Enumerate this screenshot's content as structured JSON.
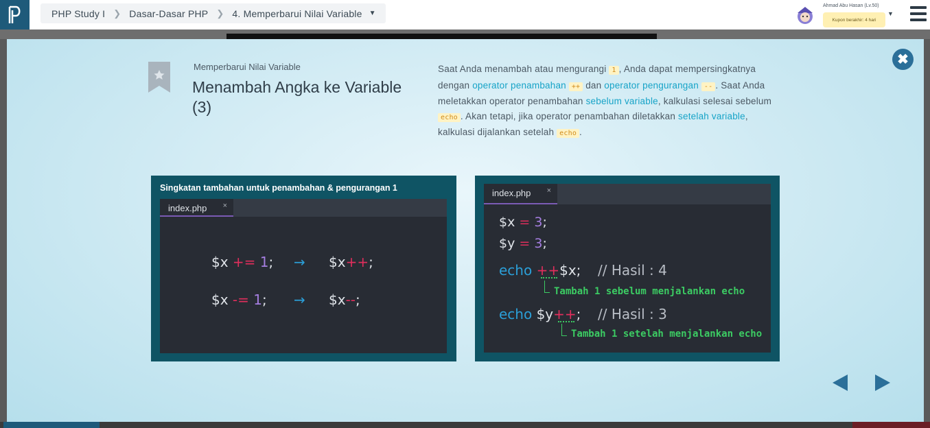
{
  "header": {
    "breadcrumb": [
      "PHP Study I",
      "Dasar-Dasar PHP",
      "4. Memperbarui Nilai Variable"
    ],
    "user_name": "Ahmad Abu Hasan (Lv.50)",
    "coupon": "Kupon berakhir: 4 hari"
  },
  "lesson": {
    "subtitle": "Memperbarui Nilai Variable",
    "title": "Menambah Angka ke Variable (3)",
    "desc": {
      "p1": "Saat Anda menambah atau mengurangi ",
      "c1": "1",
      "p2": ", Anda dapat mempersingkatnya dengan ",
      "h1": "operator penambahan",
      "c2": "++",
      "p3": " dan ",
      "h2": "operator pengurangan",
      "c3": "--",
      "p4": ". Saat Anda meletakkan operator penambahan ",
      "h3": "sebelum variable",
      "p5": ", kalkulasi selesai sebelum ",
      "c4": "echo",
      "p6": ". Akan tetapi, jika operator penambahan diletakkan ",
      "h4": "setelah variable",
      "p7": ", kalkulasi dijalankan setelah ",
      "c5": "echo",
      "p8": "."
    }
  },
  "slide_left": {
    "heading": "Singkatan tambahan untuk penambahan & pengurangan 1",
    "tab": "index.php",
    "tab_close": "×",
    "line1": {
      "var": "$x ",
      "op": "+=",
      "sp": " ",
      "num": "1",
      "end": ";",
      "arrow": "→",
      "var2": "$x",
      "op2": "++",
      "end2": ";"
    },
    "line2": {
      "var": "$x ",
      "op": "-=",
      "sp": " ",
      "num": "1",
      "end": ";",
      "arrow": "→",
      "var2": "$x",
      "op2": "--",
      "end2": ";"
    }
  },
  "slide_right": {
    "tab": "index.php",
    "tab_close": "×",
    "l1": {
      "var": "$x ",
      "op": "=",
      "num": "3",
      "end": ";"
    },
    "l2": {
      "var": "$y ",
      "op": "=",
      "num": "3",
      "end": ";"
    },
    "l3": {
      "kw": "echo ",
      "op": "++",
      "var": "$x",
      "end": ";",
      "cmt": "// Hasil : 4"
    },
    "note1": "Tambah 1 sebelum menjalankan echo",
    "l4": {
      "kw": "echo ",
      "var": "$y",
      "op": "++",
      "end": ";",
      "cmt": "// Hasil : 3"
    },
    "note2": "Tambah 1 setelah menjalankan echo"
  },
  "colors": {
    "accent": "#2b6f99",
    "highlight": "#16a3c7",
    "code_op": "#e02e5c",
    "code_num": "#a57ee0",
    "note": "#3ccc63"
  }
}
